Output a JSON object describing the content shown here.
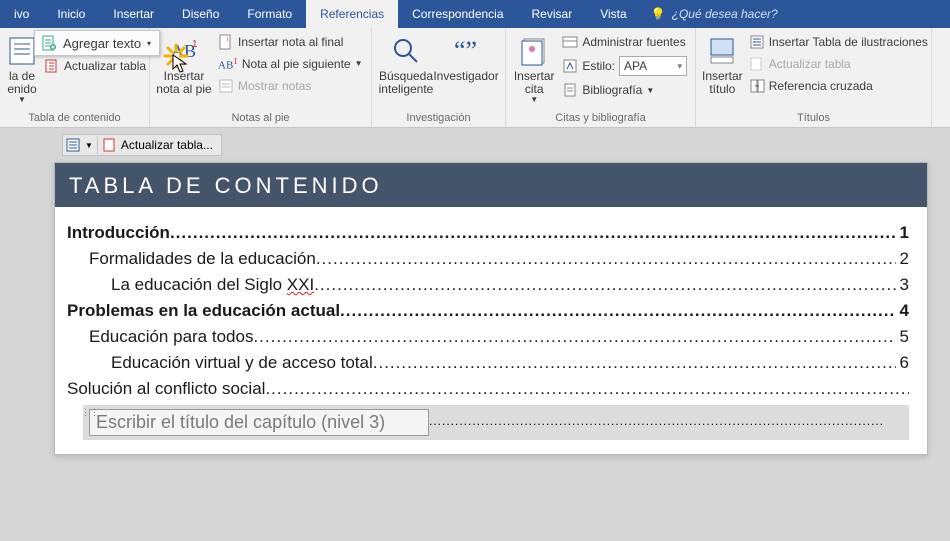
{
  "tabs": {
    "archivo": "ivo",
    "inicio": "Inicio",
    "insertar": "Insertar",
    "diseno": "Diseño",
    "formato": "Formato",
    "referencias": "Referencias",
    "correspondencia": "Correspondencia",
    "revisar": "Revisar",
    "vista": "Vista",
    "tellme": "¿Qué desea hacer?"
  },
  "popup": {
    "label": "Agregar texto"
  },
  "grp_toc": {
    "title": "Tabla de contenido",
    "big": "la de\nenido",
    "update": "Actualizar tabla"
  },
  "grp_notes": {
    "title": "Notas al pie",
    "big": "Insertar nota al pie",
    "endnote": "Insertar nota al final",
    "next": "Nota al pie siguiente",
    "show": "Mostrar notas"
  },
  "grp_research": {
    "title": "Investigación",
    "smart": "Búsqueda inteligente",
    "researcher": "Investigador"
  },
  "grp_cit": {
    "title": "Citas y bibliografía",
    "big": "Insertar cita",
    "manage": "Administrar fuentes",
    "style_lbl": "Estilo:",
    "style_val": "APA",
    "bib": "Bibliografía"
  },
  "grp_titles": {
    "title": "Títulos",
    "big": "Insertar título",
    "illus": "Insertar Tabla de ilustraciones",
    "upd": "Actualizar tabla",
    "cross": "Referencia cruzada"
  },
  "fieldbar": {
    "update": "Actualizar tabla..."
  },
  "toc": {
    "header": "TABLA DE CONTENIDO",
    "items": [
      {
        "text": "Introducción",
        "page": "1",
        "level": 0,
        "bold": true
      },
      {
        "text": "Formalidades de la educación",
        "page": "2",
        "level": 1,
        "bold": false
      },
      {
        "text_pre": "La educación del Siglo ",
        "text_squig": "XXI",
        "page": "3",
        "level": 2,
        "bold": false
      },
      {
        "text": "Problemas en la educación actual",
        "page": "4",
        "level": 0,
        "bold": true
      },
      {
        "text": "Educación para todos",
        "page": "5",
        "level": 1,
        "bold": false
      },
      {
        "text": "Educación virtual y de acceso total",
        "page": "6",
        "level": 2,
        "bold": false
      },
      {
        "text": "Solución al conflicto social",
        "page": "",
        "level": 0,
        "bold": false
      }
    ],
    "placeholder": "Escribir el título del capítulo (nivel 3)"
  }
}
